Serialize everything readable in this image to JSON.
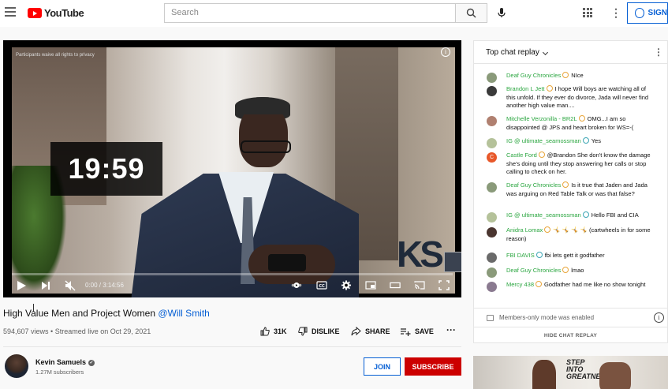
{
  "header": {
    "logo_text": "YouTube",
    "search_placeholder": "Search",
    "signin_label": "SIGN"
  },
  "player": {
    "overlay_text": "Participants waive all rights to privacy",
    "timer": "19:59",
    "time_display": "0:00 / 3:14:56",
    "watermark": "KS"
  },
  "video": {
    "title": "High Value Men and Project Women",
    "title_link": "@Will Smith",
    "views": "594,607 views",
    "streamed": "Streamed live on Oct 29, 2021",
    "likes": "31K",
    "dislike_label": "DISLIKE",
    "share_label": "SHARE",
    "save_label": "SAVE"
  },
  "channel": {
    "name": "Kevin Samuels",
    "subscribers": "1.27M subscribers",
    "join_label": "JOIN",
    "subscribe_label": "SUBSCRIBE"
  },
  "chat": {
    "header": "Top chat replay",
    "messages": [
      {
        "author": "Deaf Guy Chronicles",
        "text": "NIce",
        "avatar_color": "#8a9a7a",
        "badge": "gold"
      },
      {
        "author": "Brandon L Jett",
        "text": "I hope Will boys are watching all of this unfold. If they ever do divorce, Jada will never find another high value man....",
        "avatar_color": "#3a3a3a",
        "badge": "gold"
      },
      {
        "author": "Mitchelle Verzonilla - BR2L",
        "text": "OMG...I am so disappointed @ JPS and heart broken for WS=-(",
        "avatar_color": "#b08070",
        "badge": "gold"
      },
      {
        "author": "IG @ ultimate_seamossman",
        "text": "Yes",
        "avatar_color": "#b5c29a",
        "badge": "teal"
      },
      {
        "author": "Castle Ford",
        "text": "@Brandon She don't know the damage she's doing until they stop answering her calls or stop calling to check on her.",
        "avatar_color": "#e8582a",
        "avatar_letter": "C",
        "badge": "gold"
      },
      {
        "author": "Deaf Guy Chronicles",
        "text": "Is it true that Jaden and Jada was arguing on Red Table Talk or was that false?",
        "avatar_color": "#8a9a7a",
        "badge": "gold"
      },
      {
        "author": "IG @ ultimate_seamossman",
        "text": "Hello FBI and CIA",
        "avatar_color": "#b5c29a",
        "badge": "teal"
      },
      {
        "author": "Anidra Lomax",
        "text": "🤸 🤸 🤸 🤸 (cartwheels in for some reason)",
        "avatar_color": "#4a3530",
        "badge": "gold"
      },
      {
        "author": "FBI DAVIS",
        "text": "fbi lets gett it godfather",
        "avatar_color": "#6a6a6a",
        "badge": "teal"
      },
      {
        "author": "Deaf Guy Chronicles",
        "text": "lmao",
        "avatar_color": "#8a9a7a",
        "badge": "gold"
      },
      {
        "author": "Mercy 438",
        "text": "Godfather had me like no show tonight",
        "avatar_color": "#8a7a90",
        "badge": "gold"
      }
    ],
    "members_notice": "Members-only mode was enabled",
    "hide_label": "HIDE CHAT REPLAY"
  },
  "ad": {
    "text": "STEP INTO GREATNESS"
  }
}
